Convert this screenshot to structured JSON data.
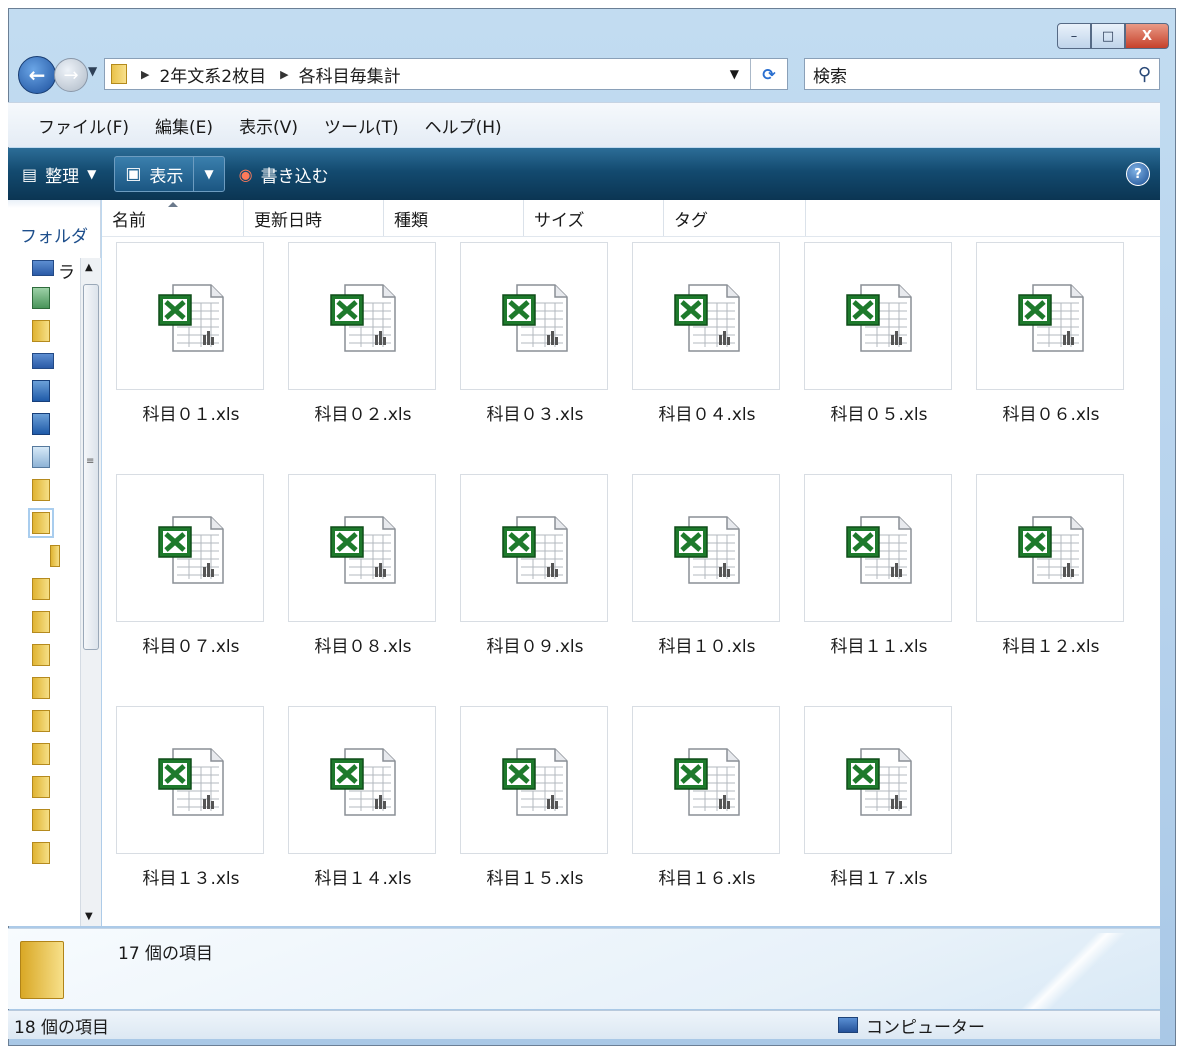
{
  "window": {
    "caption_buttons": {
      "minimize": "–",
      "maximize": "□",
      "close": "X"
    }
  },
  "address_bar": {
    "back_symbol": "←",
    "forward_symbol": "→",
    "breadcrumbs": [
      "2年文系2枚目",
      "各科目毎集計"
    ],
    "search_placeholder": "検索"
  },
  "menu": [
    "ファイル(F)",
    "編集(E)",
    "表示(V)",
    "ツール(T)",
    "ヘルプ(H)"
  ],
  "command_bar": {
    "organize": "整理",
    "view": "表示",
    "burn": "書き込む"
  },
  "nav_pane": {
    "header": "フォルダ",
    "first_item": "ラ"
  },
  "columns": [
    "名前",
    "更新日時",
    "種類",
    "サイズ",
    "タグ"
  ],
  "files": [
    "科目０１.xls",
    "科目０２.xls",
    "科目０３.xls",
    "科目０４.xls",
    "科目０５.xls",
    "科目０６.xls",
    "科目０７.xls",
    "科目０８.xls",
    "科目０９.xls",
    "科目１０.xls",
    "科目１１.xls",
    "科目１２.xls",
    "科目１３.xls",
    "科目１４.xls",
    "科目１５.xls",
    "科目１６.xls",
    "科目１７.xls"
  ],
  "details_pane": {
    "count": "17 個の項目"
  },
  "status_bar": {
    "count": "18 個の項目",
    "location": "コンピューター"
  },
  "colors": {
    "excel_green": "#1e7a2c",
    "command_bar": "#134a6f"
  }
}
